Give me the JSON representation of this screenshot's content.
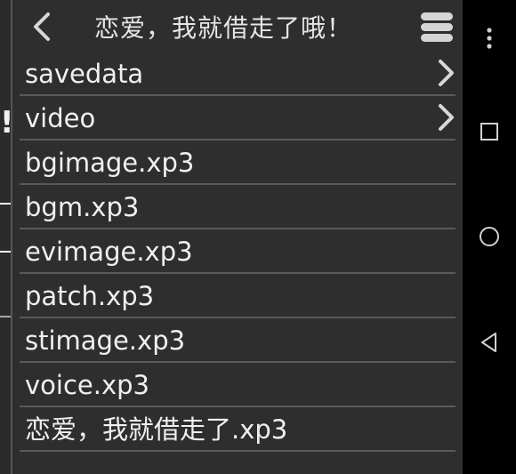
{
  "header": {
    "back_icon": "chevron-left-icon",
    "title": "恋爱，我就借走了哦！",
    "menu_icon": "hamburger-menu-icon"
  },
  "files": [
    {
      "name": "savedata",
      "is_folder": true
    },
    {
      "name": "video",
      "is_folder": true
    },
    {
      "name": "bgimage.xp3",
      "is_folder": false
    },
    {
      "name": "bgm.xp3",
      "is_folder": false
    },
    {
      "name": "evimage.xp3",
      "is_folder": false
    },
    {
      "name": "patch.xp3",
      "is_folder": false
    },
    {
      "name": "stimage.xp3",
      "is_folder": false
    },
    {
      "name": "voice.xp3",
      "is_folder": false
    },
    {
      "name": "恋爱，我就借走了.xp3",
      "is_folder": false
    }
  ],
  "navbar": {
    "overflow_icon": "overflow-dots-icon",
    "recents_icon": "recents-square-icon",
    "home_icon": "home-circle-icon",
    "back_icon": "back-triangle-icon"
  },
  "colors": {
    "panel_bg": "#2e2e2e",
    "text": "#f0f0f0",
    "separator": "#5a5a5a",
    "navbar_bg": "#000000"
  }
}
